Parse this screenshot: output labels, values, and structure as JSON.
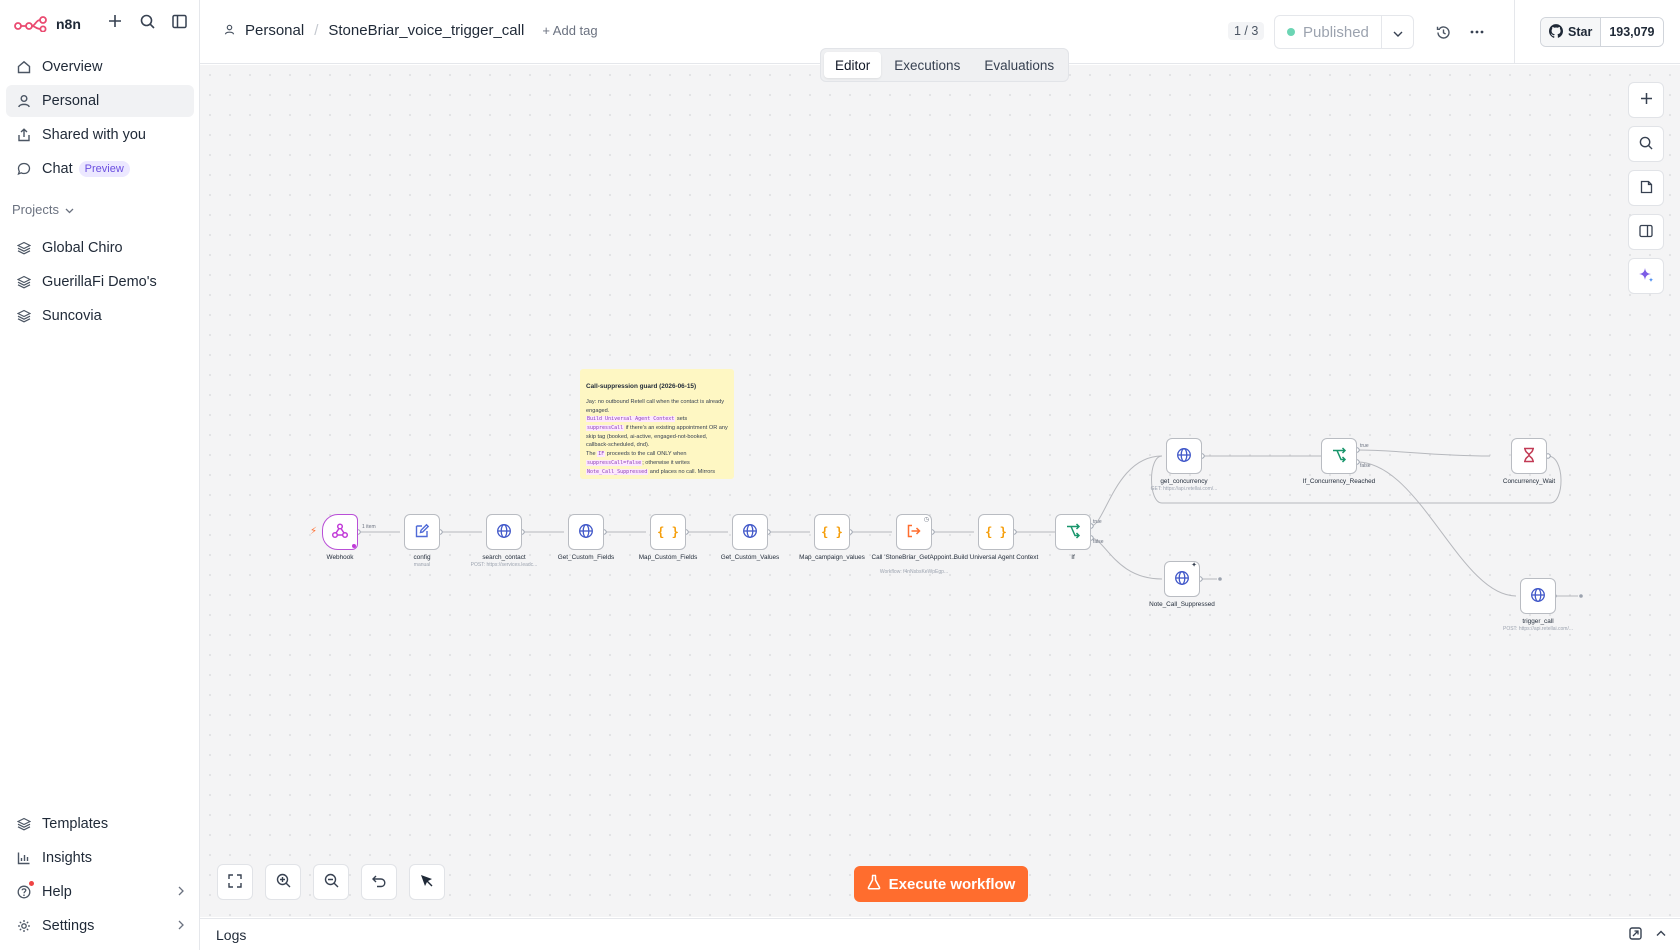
{
  "app": {
    "name": "n8n",
    "accent": "#ff6d2e",
    "brand": "#ea4b71"
  },
  "sidebar": {
    "nav": [
      {
        "label": "Overview",
        "icon": "home-icon"
      },
      {
        "label": "Personal",
        "icon": "user-icon"
      },
      {
        "label": "Shared with you",
        "icon": "share-icon"
      },
      {
        "label": "Chat",
        "icon": "chat-icon",
        "badge": "Preview"
      }
    ],
    "projects_heading": "Projects",
    "projects": [
      {
        "label": "Global Chiro"
      },
      {
        "label": "GuerillaFi Demo's"
      },
      {
        "label": "Suncovia"
      }
    ],
    "bottom": [
      {
        "label": "Templates"
      },
      {
        "label": "Insights"
      },
      {
        "label": "Help"
      },
      {
        "label": "Settings"
      }
    ]
  },
  "header": {
    "breadcrumb_project": "Personal",
    "workflow_name": "StoneBriar_voice_trigger_call",
    "add_tag": "+ Add tag",
    "version_counter": "1 / 3",
    "publish_status": "Published",
    "github_star": "Star",
    "github_count": "193,079"
  },
  "tabs": [
    {
      "label": "Editor",
      "active": true
    },
    {
      "label": "Executions",
      "active": false
    },
    {
      "label": "Evaluations",
      "active": false
    }
  ],
  "sticky": {
    "title": "Call-suppression guard (2026-06-15)",
    "lines": {
      "l1": "Jay: no outbound Retell call when the contact is already engaged.",
      "c1": "Build Universal Agent Context",
      "l2": " sets",
      "c2": "suppressCall",
      "l3": " if there's an existing appointment OR any skip tag (booked, ai-active, engaged-not-booked, callback-scheduled, dnd).",
      "l4": "The ",
      "c3": "IF",
      "l5": " proceeds to the call ONLY when",
      "c4": "suppressCall=false",
      "l6": "; otherwise it writes",
      "c5": "Note_Call_Suppressed",
      "l7": " and places no call. Mirrors"
    }
  },
  "nodes": [
    {
      "label": "Webhook",
      "sub": ""
    },
    {
      "label": "config",
      "sub": "manual"
    },
    {
      "label": "search_contact",
      "sub": "POST: https://services.leadc..."
    },
    {
      "label": "Get_Custom_Fields",
      "sub": ""
    },
    {
      "label": "Map_Custom_Fields",
      "sub": ""
    },
    {
      "label": "Get_Custom_Values",
      "sub": ""
    },
    {
      "label": "Map_campaign_values",
      "sub": ""
    },
    {
      "label": "Call 'StoneBriar_GetAppoint...",
      "sub": "Workflow: f4nNsbsKeWpEgp..."
    },
    {
      "label": "Build Universal Agent Context",
      "sub": ""
    },
    {
      "label": "If",
      "sub": ""
    },
    {
      "label": "get_concurrency",
      "sub": "GET: https://api.retellai.com/..."
    },
    {
      "label": "If_Concurrency_Reached",
      "sub": ""
    },
    {
      "label": "Concurrency_Wait",
      "sub": ""
    },
    {
      "label": "Note_Call_Suppressed",
      "sub": ""
    },
    {
      "label": "trigger_call",
      "sub": "POST: https://api.retellai.com/..."
    }
  ],
  "edge_labels": {
    "webhook_items": "1 item",
    "if_true": "true",
    "if_false": "false",
    "conc_true": "true",
    "conc_false": "false"
  },
  "execute_button": "Execute workflow",
  "logs_label": "Logs"
}
